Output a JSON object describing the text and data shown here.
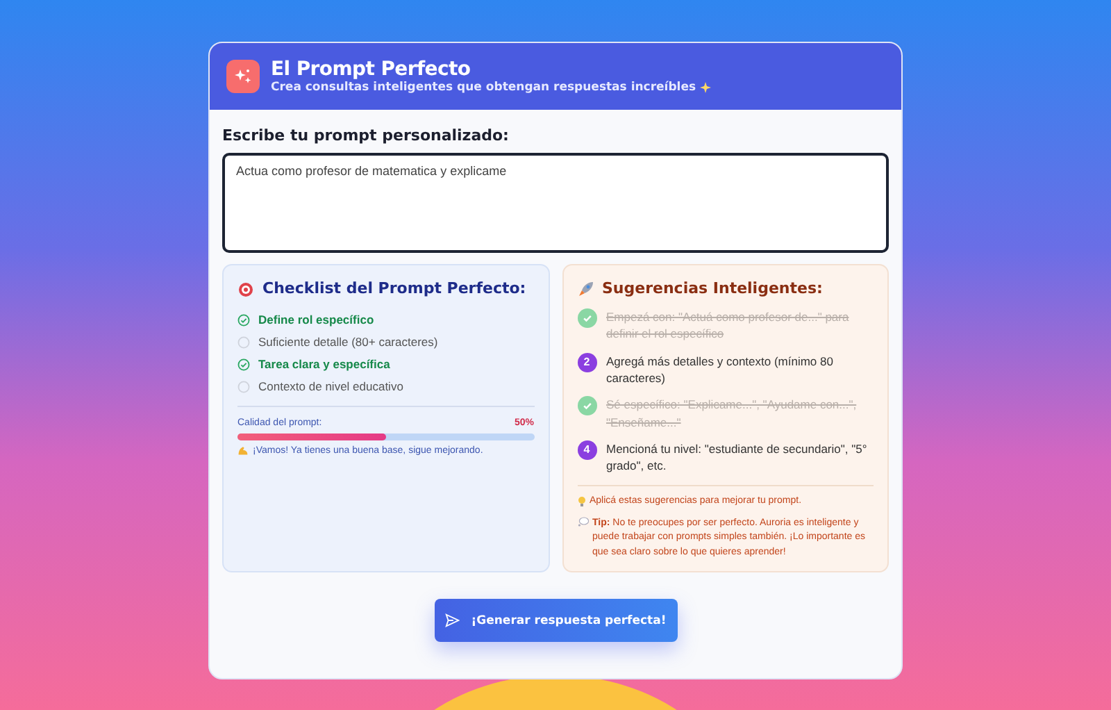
{
  "header": {
    "title": "El Prompt Perfecto",
    "subtitle": "Crea consultas inteligentes que obtengan respuestas increíbles"
  },
  "prompt": {
    "label": "Escribe tu prompt personalizado:",
    "value": "Actua como profesor de matematica y explicame"
  },
  "checklist": {
    "title": "Checklist del Prompt Perfecto:",
    "items": [
      {
        "label": "Define rol específico",
        "checked": true
      },
      {
        "label": "Suficiente detalle (80+ caracteres)",
        "checked": false
      },
      {
        "label": "Tarea clara y específica",
        "checked": true
      },
      {
        "label": "Contexto de nivel educativo",
        "checked": false
      }
    ],
    "quality": {
      "label": "Calidad del prompt:",
      "reading": "50%",
      "level": 0.5
    },
    "message": "¡Vamos! Ya tienes una buena base, sigue mejorando."
  },
  "suggestions": {
    "title": "Sugerencias Inteligentes:",
    "items": [
      {
        "text": "Empezá con: \"Actuá como profesor de...\" para definir el rol específico",
        "done": true
      },
      {
        "number": "2",
        "text": "Agregá más detalles y contexto (mínimo 80 caracteres)",
        "done": false
      },
      {
        "text": "Sé específico: \"Explicame...\", \"Ayudame con...\", \"Enseñame...\"",
        "done": true
      },
      {
        "number": "4",
        "text": "Mencioná tu nivel: \"estudiante de secundario\", \"5° grado\", etc.",
        "done": false
      }
    ],
    "hint": "Aplicá estas sugerencias para mejorar tu prompt.",
    "tip": "**Tip:** No te preocupes por ser perfecto. Auroria es inteligente y puede trabajar con prompts simples también. ¡Lo importante es que sea claro sobre lo que quieres aprender!"
  },
  "button": {
    "label": "¡Generar respuesta perfecta!"
  }
}
